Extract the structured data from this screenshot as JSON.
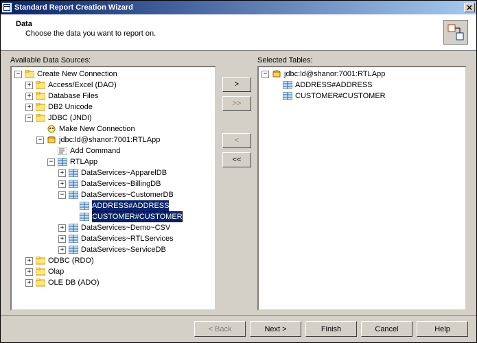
{
  "window": {
    "title": "Standard Report Creation Wizard"
  },
  "header": {
    "heading": "Data",
    "subtext": "Choose the data you want to report on."
  },
  "labels": {
    "available": "Available Data Sources:",
    "selected": "Selected Tables:"
  },
  "buttons": {
    "add": ">",
    "addAll": ">>",
    "remove": "<",
    "removeAll": "<<",
    "back": "< Back",
    "next": "Next >",
    "finish": "Finish",
    "cancel": "Cancel",
    "help": "Help"
  },
  "availableTree": {
    "root": "Create New Connection",
    "items": [
      "Access/Excel (DAO)",
      "Database Files",
      "DB2 Unicode"
    ],
    "jdbc": {
      "label": "JDBC (JNDI)",
      "makeNew": "Make New Connection",
      "conn": {
        "label": "jdbc:ld@shanor:7001:RTLApp",
        "addCmd": "Add Command",
        "rtl": {
          "label": "RTLApp",
          "ds1": "DataServices~ApparelDB",
          "ds2": "DataServices~BillingDB",
          "ds3": {
            "label": "DataServices~CustomerDB",
            "t1": "ADDRESS#ADDRESS",
            "t2": "CUSTOMER#CUSTOMER"
          },
          "ds4": "DataServices~Demo~CSV",
          "ds5": "DataServices~RTLServices",
          "ds6": "DataServices~ServiceDB"
        }
      }
    },
    "tail": [
      "ODBC (RDO)",
      "Olap",
      "OLE DB (ADO)"
    ]
  },
  "selectedTree": {
    "root": "jdbc:ld@shanor:7001:RTLApp",
    "items": [
      "ADDRESS#ADDRESS",
      "CUSTOMER#CUSTOMER"
    ]
  }
}
